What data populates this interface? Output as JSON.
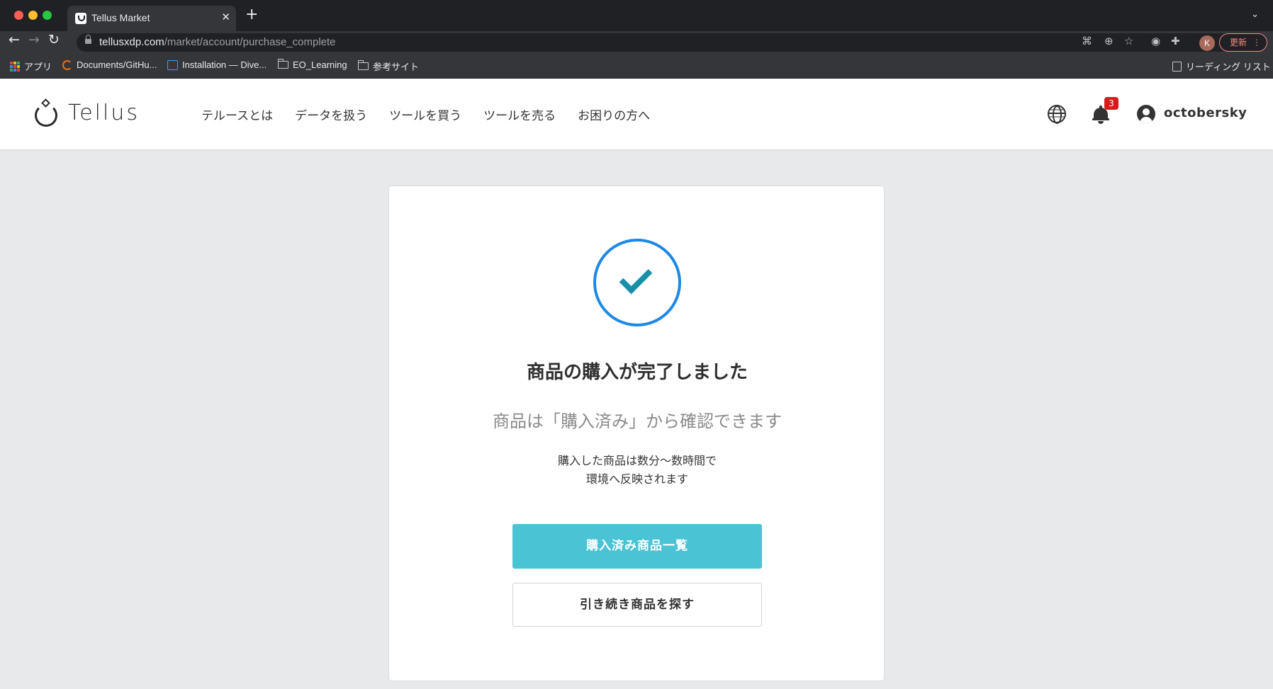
{
  "browser": {
    "tab_title": "Tellus Market",
    "tab_close": "✕",
    "new_tab": "+",
    "url_host": "tellusxdp.com",
    "url_path": "/market/account/purchase_complete",
    "update_label": "更新",
    "profile_initial": "K",
    "bookmarks": [
      {
        "label": "アプリ",
        "icon": "apps-grid-icon"
      },
      {
        "label": "Documents/GitHu...",
        "icon": "bookmark-site-icon"
      },
      {
        "label": "Installation — Dive...",
        "icon": "bookmark-site-icon"
      },
      {
        "label": "EO_Learning",
        "icon": "folder-icon"
      },
      {
        "label": "参考サイト",
        "icon": "folder-icon"
      }
    ],
    "reading_list": "リーディング リスト"
  },
  "header": {
    "logo_text": "Tellus",
    "nav": [
      "テルースとは",
      "データを扱う",
      "ツールを買う",
      "ツールを売る",
      "お困りの方へ"
    ],
    "notification_count": "3",
    "username": "octobersky"
  },
  "main": {
    "title": "商品の購入が完了しました",
    "subtitle": "商品は「購入済み」から確認できます",
    "note_line1": "購入した商品は数分〜数時間で",
    "note_line2": "環境へ反映されます",
    "primary_button": "購入済み商品一覧",
    "secondary_button": "引き続き商品を探す"
  },
  "colors": {
    "accent": "#4ac3d4",
    "check_circle": "#1e88e5",
    "check_mark": "#1a8fa8",
    "badge": "#d81b1b"
  }
}
